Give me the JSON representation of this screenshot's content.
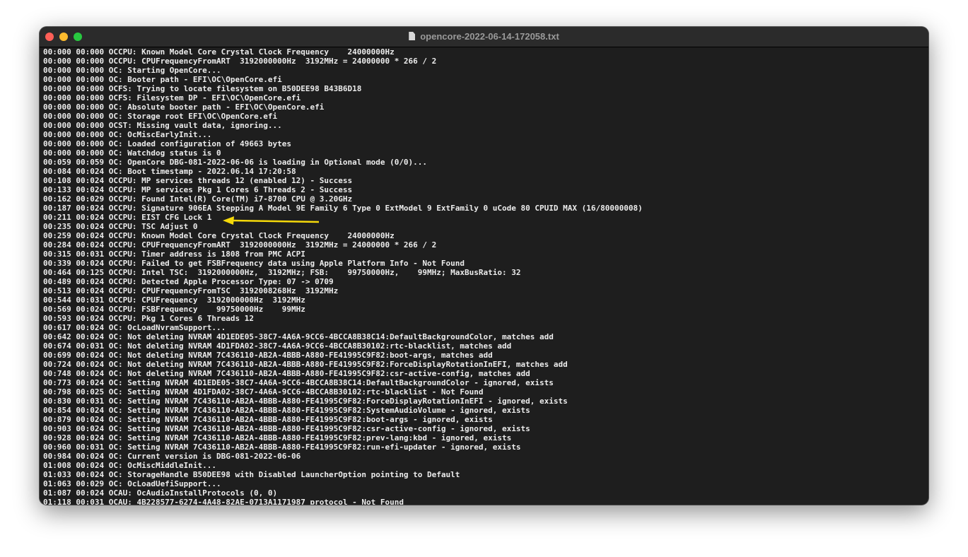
{
  "window": {
    "title": "opencore-2022-06-14-172058.txt",
    "icon": "document-icon"
  },
  "annotation": {
    "arrow_color": "#f5d90a",
    "points_to_line": 18
  },
  "lines": [
    "00:000 00:000 OCCPU: Known Model Core Crystal Clock Frequency    24000000Hz",
    "00:000 00:000 OCCPU: CPUFrequencyFromART  3192000000Hz  3192MHz = 24000000 * 266 / 2",
    "00:000 00:000 OC: Starting OpenCore...",
    "00:000 00:000 OC: Booter path - EFI\\OC\\OpenCore.efi",
    "00:000 00:000 OCFS: Trying to locate filesystem on B50DEE98 B43B6D18",
    "00:000 00:000 OCFS: Filesystem DP - EFI\\OC\\OpenCore.efi",
    "00:000 00:000 OC: Absolute booter path - EFI\\OC\\OpenCore.efi",
    "00:000 00:000 OC: Storage root EFI\\OC\\OpenCore.efi",
    "00:000 00:000 OCST: Missing vault data, ignoring...",
    "00:000 00:000 OC: OcMiscEarlyInit...",
    "00:000 00:000 OC: Loaded configuration of 49663 bytes",
    "00:000 00:000 OC: Watchdog status is 0",
    "00:059 00:059 OC: OpenCore DBG-081-2022-06-06 is loading in Optional mode (0/0)...",
    "00:084 00:024 OC: Boot timestamp - 2022.06.14 17:20:58",
    "00:108 00:024 OCCPU: MP services threads 12 (enabled 12) - Success",
    "00:133 00:024 OCCPU: MP services Pkg 1 Cores 6 Threads 2 - Success",
    "00:162 00:029 OCCPU: Found Intel(R) Core(TM) i7-8700 CPU @ 3.20GHz",
    "00:187 00:024 OCCPU: Signature 906EA Stepping A Model 9E Family 6 Type 0 ExtModel 9 ExtFamily 0 uCode 80 CPUID MAX (16/80000008)",
    "00:211 00:024 OCCPU: EIST CFG Lock 1",
    "00:235 00:024 OCCPU: TSC Adjust 0",
    "00:259 00:024 OCCPU: Known Model Core Crystal Clock Frequency    24000000Hz",
    "00:284 00:024 OCCPU: CPUFrequencyFromART  3192000000Hz  3192MHz = 24000000 * 266 / 2",
    "00:315 00:031 OCCPU: Timer address is 1808 from PMC ACPI",
    "00:339 00:024 OCCPU: Failed to get FSBFrequency data using Apple Platform Info - Not Found",
    "00:464 00:125 OCCPU: Intel TSC:  3192000000Hz,  3192MHz; FSB:    99750000Hz,    99MHz; MaxBusRatio: 32",
    "00:489 00:024 OCCPU: Detected Apple Processor Type: 07 -> 0709",
    "00:513 00:024 OCCPU: CPUFrequencyFromTSC  3192008268Hz  3192MHz",
    "00:544 00:031 OCCPU: CPUFrequency  3192000000Hz  3192MHz",
    "00:569 00:024 OCCPU: FSBFrequency    99750000Hz    99MHz",
    "00:593 00:024 OCCPU: Pkg 1 Cores 6 Threads 12",
    "00:617 00:024 OC: OcLoadNvramSupport...",
    "00:642 00:024 OC: Not deleting NVRAM 4D1EDE05-38C7-4A6A-9CC6-4BCCA8B38C14:DefaultBackgroundColor, matches add",
    "00:674 00:031 OC: Not deleting NVRAM 4D1FDA02-38C7-4A6A-9CC6-4BCCA8B30102:rtc-blacklist, matches add",
    "00:699 00:024 OC: Not deleting NVRAM 7C436110-AB2A-4BBB-A880-FE41995C9F82:boot-args, matches add",
    "00:724 00:024 OC: Not deleting NVRAM 7C436110-AB2A-4BBB-A880-FE41995C9F82:ForceDisplayRotationInEFI, matches add",
    "00:748 00:024 OC: Not deleting NVRAM 7C436110-AB2A-4BBB-A880-FE41995C9F82:csr-active-config, matches add",
    "00:773 00:024 OC: Setting NVRAM 4D1EDE05-38C7-4A6A-9CC6-4BCCA8B38C14:DefaultBackgroundColor - ignored, exists",
    "00:798 00:025 OC: Setting NVRAM 4D1FDA02-38C7-4A6A-9CC6-4BCCA8B30102:rtc-blacklist - Not Found",
    "00:830 00:031 OC: Setting NVRAM 7C436110-AB2A-4BBB-A880-FE41995C9F82:ForceDisplayRotationInEFI - ignored, exists",
    "00:854 00:024 OC: Setting NVRAM 7C436110-AB2A-4BBB-A880-FE41995C9F82:SystemAudioVolume - ignored, exists",
    "00:879 00:024 OC: Setting NVRAM 7C436110-AB2A-4BBB-A880-FE41995C9F82:boot-args - ignored, exists",
    "00:903 00:024 OC: Setting NVRAM 7C436110-AB2A-4BBB-A880-FE41995C9F82:csr-active-config - ignored, exists",
    "00:928 00:024 OC: Setting NVRAM 7C436110-AB2A-4BBB-A880-FE41995C9F82:prev-lang:kbd - ignored, exists",
    "00:960 00:031 OC: Setting NVRAM 7C436110-AB2A-4BBB-A880-FE41995C9F82:run-efi-updater - ignored, exists",
    "00:984 00:024 OC: Current version is DBG-081-2022-06-06",
    "01:008 00:024 OC: OcMiscMiddleInit...",
    "01:033 00:024 OC: StorageHandle B50DEE98 with Disabled LauncherOption pointing to Default",
    "01:063 00:029 OC: OcLoadUefiSupport...",
    "01:087 00:024 OCAU: OcAudioInstallProtocols (0, 0)",
    "01:118 00:031 OCAU: 4B228577-6274-4A48-82AE-0713A1171987 protocol - Not Found"
  ]
}
